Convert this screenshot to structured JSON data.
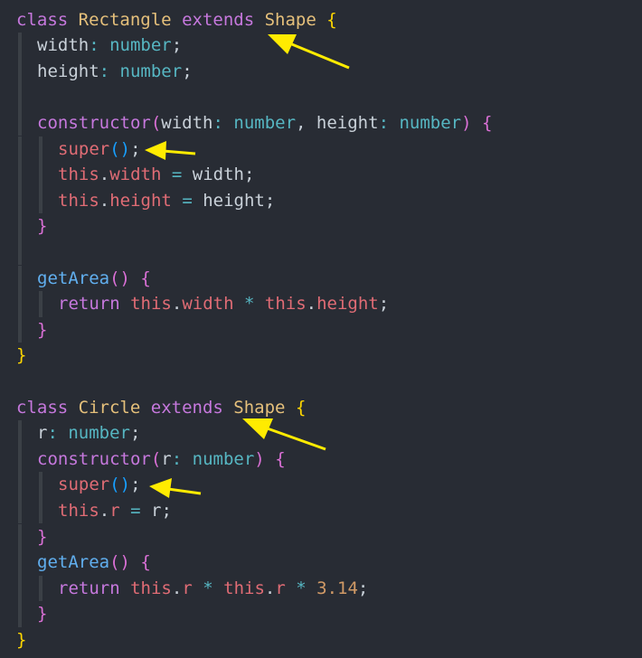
{
  "editor": {
    "lines": [
      {
        "tokens": [
          [
            "kw",
            "class"
          ],
          [
            "pl",
            " "
          ],
          [
            "cls",
            "Rectangle"
          ],
          [
            "pl",
            " "
          ],
          [
            "kw",
            "extends"
          ],
          [
            "pl",
            " "
          ],
          [
            "cls",
            "Shape"
          ],
          [
            "pl",
            " "
          ],
          [
            "br1",
            "{"
          ]
        ]
      },
      {
        "tokens": [
          [
            "pl",
            "width"
          ],
          [
            "op",
            ":"
          ],
          [
            "pl",
            " "
          ],
          [
            "ty",
            "number"
          ],
          [
            "pl",
            ";"
          ]
        ]
      },
      {
        "tokens": [
          [
            "pl",
            "height"
          ],
          [
            "op",
            ":"
          ],
          [
            "pl",
            " "
          ],
          [
            "ty",
            "number"
          ],
          [
            "pl",
            ";"
          ]
        ]
      },
      {
        "tokens": []
      },
      {
        "tokens": [
          [
            "kw",
            "constructor"
          ],
          [
            "br2",
            "("
          ],
          [
            "pl",
            "width"
          ],
          [
            "op",
            ":"
          ],
          [
            "pl",
            " "
          ],
          [
            "ty",
            "number"
          ],
          [
            "pl",
            ", height"
          ],
          [
            "op",
            ":"
          ],
          [
            "pl",
            " "
          ],
          [
            "ty",
            "number"
          ],
          [
            "br2",
            ")"
          ],
          [
            "pl",
            " "
          ],
          [
            "br2",
            "{"
          ]
        ]
      },
      {
        "tokens": [
          [
            "var",
            "super"
          ],
          [
            "br3",
            "()"
          ],
          [
            "pl",
            ";"
          ]
        ]
      },
      {
        "tokens": [
          [
            "var",
            "this"
          ],
          [
            "pl",
            "."
          ],
          [
            "var",
            "width"
          ],
          [
            "pl",
            " "
          ],
          [
            "op",
            "="
          ],
          [
            "pl",
            " width;"
          ]
        ]
      },
      {
        "tokens": [
          [
            "var",
            "this"
          ],
          [
            "pl",
            "."
          ],
          [
            "var",
            "height"
          ],
          [
            "pl",
            " "
          ],
          [
            "op",
            "="
          ],
          [
            "pl",
            " height;"
          ]
        ]
      },
      {
        "tokens": [
          [
            "br2",
            "}"
          ]
        ]
      },
      {
        "tokens": []
      },
      {
        "tokens": [
          [
            "fn",
            "getArea"
          ],
          [
            "br2",
            "()"
          ],
          [
            "pl",
            " "
          ],
          [
            "br2",
            "{"
          ]
        ]
      },
      {
        "tokens": [
          [
            "kw",
            "return"
          ],
          [
            "pl",
            " "
          ],
          [
            "var",
            "this"
          ],
          [
            "pl",
            "."
          ],
          [
            "var",
            "width"
          ],
          [
            "pl",
            " "
          ],
          [
            "op",
            "*"
          ],
          [
            "pl",
            " "
          ],
          [
            "var",
            "this"
          ],
          [
            "pl",
            "."
          ],
          [
            "var",
            "height"
          ],
          [
            "pl",
            ";"
          ]
        ]
      },
      {
        "tokens": [
          [
            "br2",
            "}"
          ]
        ]
      },
      {
        "tokens": [
          [
            "br1",
            "}"
          ]
        ]
      },
      {
        "tokens": []
      },
      {
        "tokens": [
          [
            "kw",
            "class"
          ],
          [
            "pl",
            " "
          ],
          [
            "cls",
            "Circle"
          ],
          [
            "pl",
            " "
          ],
          [
            "kw",
            "extends"
          ],
          [
            "pl",
            " "
          ],
          [
            "cls",
            "Shape"
          ],
          [
            "pl",
            " "
          ],
          [
            "br1",
            "{"
          ]
        ]
      },
      {
        "tokens": [
          [
            "pl",
            "r"
          ],
          [
            "op",
            ":"
          ],
          [
            "pl",
            " "
          ],
          [
            "ty",
            "number"
          ],
          [
            "pl",
            ";"
          ]
        ]
      },
      {
        "tokens": [
          [
            "kw",
            "constructor"
          ],
          [
            "br2",
            "("
          ],
          [
            "pl",
            "r"
          ],
          [
            "op",
            ":"
          ],
          [
            "pl",
            " "
          ],
          [
            "ty",
            "number"
          ],
          [
            "br2",
            ")"
          ],
          [
            "pl",
            " "
          ],
          [
            "br2",
            "{"
          ]
        ]
      },
      {
        "tokens": [
          [
            "var",
            "super"
          ],
          [
            "br3",
            "()"
          ],
          [
            "pl",
            ";"
          ]
        ]
      },
      {
        "tokens": [
          [
            "var",
            "this"
          ],
          [
            "pl",
            "."
          ],
          [
            "var",
            "r"
          ],
          [
            "pl",
            " "
          ],
          [
            "op",
            "="
          ],
          [
            "pl",
            " r;"
          ]
        ]
      },
      {
        "tokens": [
          [
            "br2",
            "}"
          ]
        ]
      },
      {
        "tokens": [
          [
            "fn",
            "getArea"
          ],
          [
            "br2",
            "()"
          ],
          [
            "pl",
            " "
          ],
          [
            "br2",
            "{"
          ]
        ]
      },
      {
        "tokens": [
          [
            "kw",
            "return"
          ],
          [
            "pl",
            " "
          ],
          [
            "var",
            "this"
          ],
          [
            "pl",
            "."
          ],
          [
            "var",
            "r"
          ],
          [
            "pl",
            " "
          ],
          [
            "op",
            "*"
          ],
          [
            "pl",
            " "
          ],
          [
            "var",
            "this"
          ],
          [
            "pl",
            "."
          ],
          [
            "var",
            "r"
          ],
          [
            "pl",
            " "
          ],
          [
            "op",
            "*"
          ],
          [
            "pl",
            " "
          ],
          [
            "num",
            "3.14"
          ],
          [
            "pl",
            ";"
          ]
        ]
      },
      {
        "tokens": [
          [
            "br2",
            "}"
          ]
        ]
      },
      {
        "tokens": [
          [
            "br1",
            "}"
          ]
        ]
      }
    ]
  },
  "colors": {
    "background": "#282c34",
    "keyword": "#c678dd",
    "class_name": "#e5c07b",
    "type": "#56b6c2",
    "function": "#61afef",
    "variable": "#e06c75",
    "plain": "#c9d1d9",
    "number": "#d19a66",
    "bracket_level1": "#ffd700",
    "bracket_level2": "#da70d6",
    "bracket_level3": "#179fff",
    "annotation_arrow": "#ffeb00"
  }
}
